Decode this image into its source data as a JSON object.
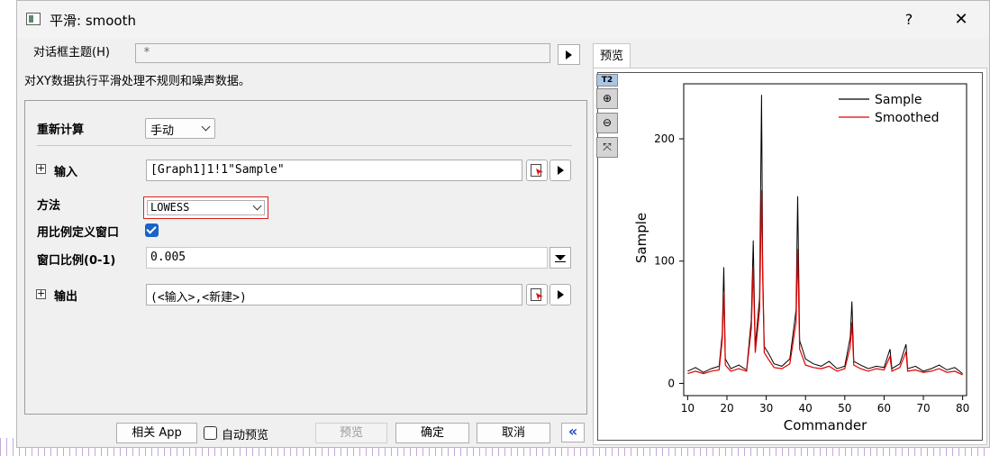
{
  "window": {
    "title": "平滑: smooth",
    "help_label": "?",
    "close_label": "✕"
  },
  "theme": {
    "label": "对话框主题(H)",
    "value": "*"
  },
  "description": "对XY数据执行平滑处理不规则和噪声数据。",
  "form": {
    "recalc": {
      "label": "重新计算",
      "value": "手动"
    },
    "input": {
      "label": "输入",
      "value": "[Graph1]1!1\"Sample\""
    },
    "method": {
      "label": "方法",
      "value": "LOWESS"
    },
    "use_ratio": {
      "label": "用比例定义窗口",
      "checked": true
    },
    "window_ratio": {
      "label": "窗口比例(0-1)",
      "value": "0.005"
    },
    "output": {
      "label": "输出",
      "value": "(<输入>,<新建>)"
    }
  },
  "buttons": {
    "related_app": "相关 App",
    "auto_preview": "自动预览",
    "preview": "预览",
    "ok": "确定",
    "cancel": "取消",
    "collapse": "«"
  },
  "preview": {
    "tab_label": "预览",
    "tool_t2": "T2"
  },
  "colors": {
    "sample": "#000000",
    "smoothed": "#dd0000",
    "accent": "#1a63c7",
    "highlight_border": "#dc2020"
  },
  "chart_data": {
    "type": "line",
    "title": "",
    "xlabel": "Commander",
    "ylabel": "Sample",
    "xlim": [
      9,
      81
    ],
    "ylim": [
      -10,
      245
    ],
    "xticks": [
      10,
      20,
      30,
      40,
      50,
      60,
      70,
      80
    ],
    "yticks": [
      0,
      100,
      200
    ],
    "legend_position": "top-right",
    "series": [
      {
        "name": "Sample",
        "color": "#000000",
        "x": [
          10,
          12,
          14,
          16,
          18,
          18.8,
          19.2,
          19.6,
          21,
          23,
          25,
          26.2,
          26.7,
          27.2,
          28.3,
          28.8,
          29.1,
          29.5,
          30.5,
          32,
          34,
          36,
          37.6,
          38,
          38.5,
          40,
          42,
          44,
          46,
          48,
          50,
          51.4,
          51.8,
          52.3,
          54,
          56,
          58,
          60,
          61.5,
          62,
          64,
          65.6,
          66,
          68,
          70,
          72,
          74,
          76,
          78,
          80
        ],
        "values": [
          10,
          13,
          9,
          12,
          14,
          40,
          95,
          20,
          12,
          15,
          11,
          52,
          117,
          30,
          70,
          236,
          95,
          30,
          25,
          16,
          14,
          20,
          60,
          153,
          35,
          20,
          16,
          14,
          18,
          12,
          14,
          38,
          67,
          18,
          15,
          12,
          14,
          13,
          28,
          12,
          16,
          32,
          12,
          14,
          10,
          12,
          15,
          11,
          13,
          8
        ]
      },
      {
        "name": "Smoothed",
        "color": "#dd0000",
        "x": [
          10,
          12,
          14,
          16,
          18,
          18.8,
          19.2,
          19.6,
          21,
          23,
          25,
          26.2,
          26.7,
          27.2,
          28.3,
          28.8,
          29.1,
          29.5,
          30.5,
          32,
          34,
          36,
          37.6,
          38,
          38.5,
          40,
          42,
          44,
          46,
          48,
          50,
          51.4,
          51.8,
          52.3,
          54,
          56,
          58,
          60,
          61.5,
          62,
          64,
          65.6,
          66,
          68,
          70,
          72,
          74,
          76,
          78,
          80
        ],
        "values": [
          8,
          10,
          8,
          10,
          11,
          35,
          75,
          15,
          10,
          12,
          10,
          45,
          95,
          25,
          60,
          158,
          85,
          25,
          20,
          13,
          12,
          16,
          50,
          110,
          28,
          15,
          13,
          12,
          14,
          10,
          12,
          30,
          50,
          15,
          12,
          10,
          12,
          11,
          22,
          10,
          13,
          26,
          10,
          11,
          9,
          10,
          12,
          9,
          10,
          7
        ]
      }
    ]
  }
}
